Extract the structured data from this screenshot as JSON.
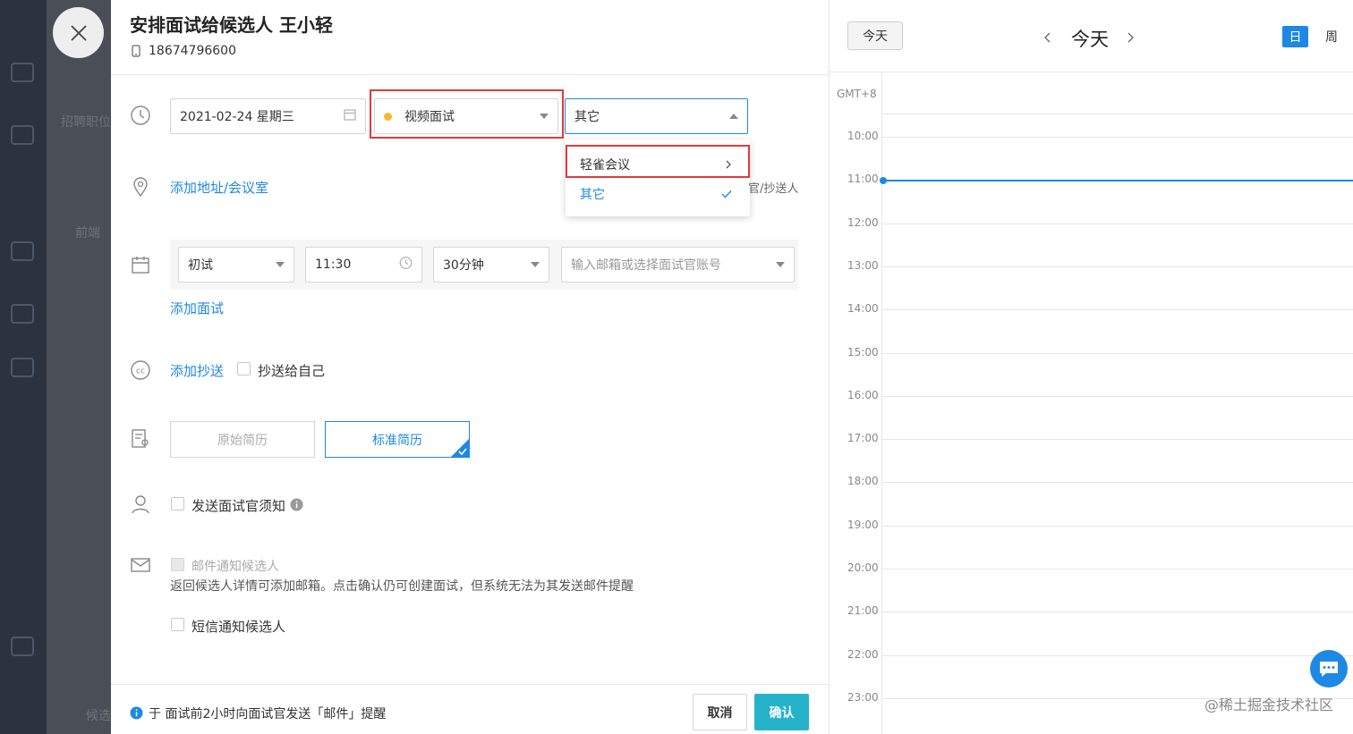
{
  "background": {
    "sidebar_texts": [
      "招聘职位",
      "前端",
      "候选"
    ]
  },
  "header": {
    "title": "安排面试给候选人 王小轻",
    "phone": "18674796600"
  },
  "schedule": {
    "date": "2021-02-24 星期三",
    "mode": "视频面试",
    "mode_dot_color": "#f5b82e",
    "platform": "其它",
    "platform_options": [
      {
        "label": "轻雀会议",
        "has_submenu": true
      },
      {
        "label": "其它",
        "selected": true
      }
    ],
    "cc_hint": "官/抄送人"
  },
  "address": {
    "link": "添加地址/会议室"
  },
  "interview": {
    "round": "初试",
    "time": "11:30",
    "duration": "30分钟",
    "interviewer_placeholder": "输入邮箱或选择面试官账号",
    "add_link": "添加面试"
  },
  "cc": {
    "add_link": "添加抄送",
    "self_label": "抄送给自己"
  },
  "resume": {
    "original": "原始简历",
    "standard": "标准简历"
  },
  "notify": {
    "interviewer_notice": "发送面试官须知",
    "email_candidate": "邮件通知候选人",
    "email_hint": "返回候选人详情可添加邮箱。点击确认仍可创建面试，但系统无法为其发送邮件提醒",
    "sms_candidate": "短信通知候选人"
  },
  "footer": {
    "reminder": "于 面试前2小时向面试官发送「邮件」提醒",
    "cancel": "取消",
    "confirm": "确认"
  },
  "calendar": {
    "today_button": "今天",
    "current_label": "今天",
    "view_day": "日",
    "view_week": "周",
    "timezone": "GMT+8",
    "hours": [
      "10:00",
      "11:00",
      "12:00",
      "13:00",
      "14:00",
      "15:00",
      "16:00",
      "17:00",
      "18:00",
      "19:00",
      "20:00",
      "21:00",
      "22:00",
      "23:00"
    ],
    "accent": "#1e88e5"
  },
  "watermark_text": "@稀土掘金技术社区",
  "colors": {
    "accent": "#1e88e5",
    "confirm": "#26b3c9",
    "highlight": "#e03b3b"
  }
}
